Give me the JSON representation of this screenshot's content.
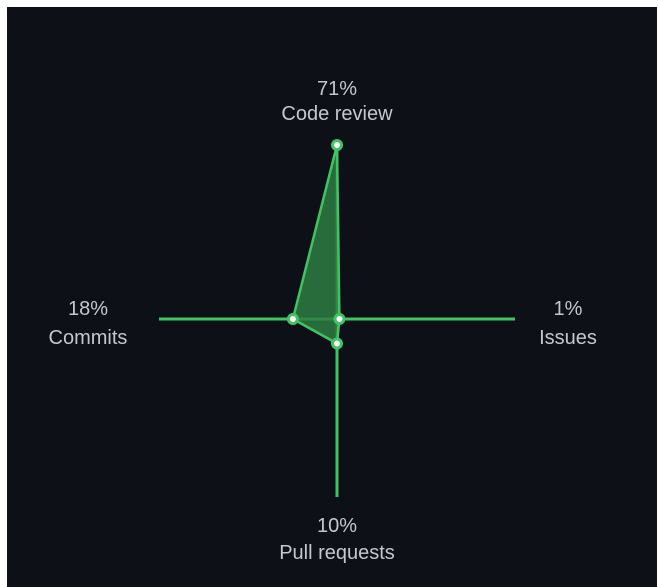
{
  "colors": {
    "background": "#0d1117",
    "axis": "#40c463",
    "area_fill": "#2f7d42",
    "point_fill": "#ffffff",
    "text": "#c3c8cf"
  },
  "chart_data": {
    "type": "radar",
    "title": "",
    "axes": [
      {
        "name": "Code review",
        "value": 71,
        "label": "71%",
        "direction": "up"
      },
      {
        "name": "Issues",
        "value": 1,
        "label": "1%",
        "direction": "right"
      },
      {
        "name": "Pull requests",
        "value": 10,
        "label": "10%",
        "direction": "down"
      },
      {
        "name": "Commits",
        "value": 18,
        "label": "18%",
        "direction": "left"
      }
    ],
    "max": 100,
    "grid": false,
    "legend": "none"
  }
}
